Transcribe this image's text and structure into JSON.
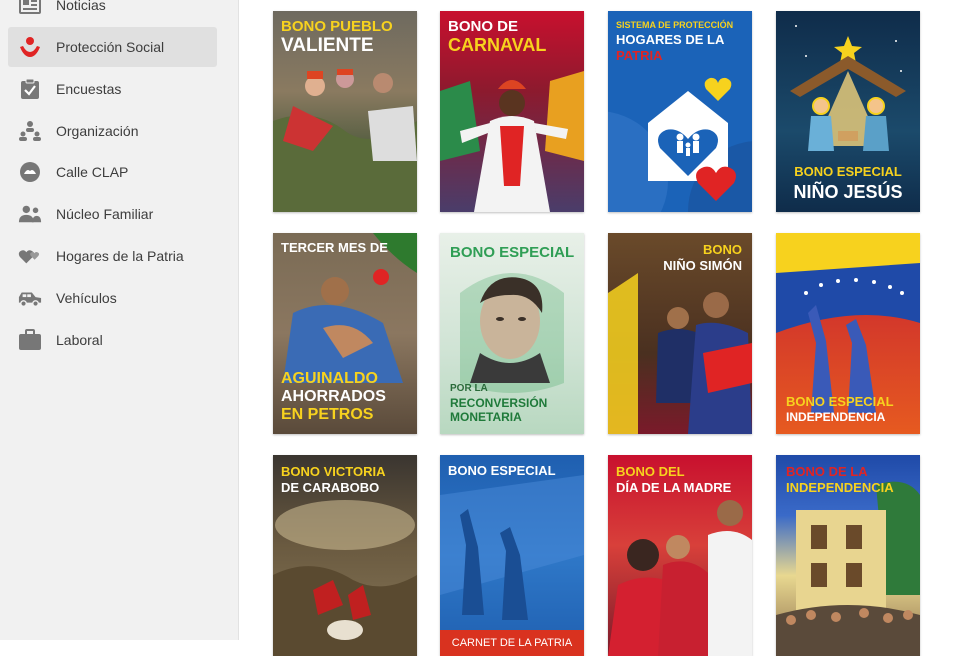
{
  "sidebar": {
    "items": [
      {
        "label": "Noticias",
        "icon": "newspaper-icon"
      },
      {
        "label": "Protección Social",
        "icon": "hands-heart-icon",
        "active": true
      },
      {
        "label": "Encuestas",
        "icon": "clipboard-check-icon"
      },
      {
        "label": "Organización",
        "icon": "org-chart-icon"
      },
      {
        "label": "Calle CLAP",
        "icon": "clap-icon"
      },
      {
        "label": "Núcleo Familiar",
        "icon": "family-icon"
      },
      {
        "label": "Hogares de la Patria",
        "icon": "hearts-icon"
      },
      {
        "label": "Vehículos",
        "icon": "car-icon"
      },
      {
        "label": "Laboral",
        "icon": "briefcase-icon"
      }
    ]
  },
  "colors": {
    "yellow": "#f7d21e",
    "red": "#e02424",
    "sidebar_bg": "#f1f1f1",
    "active_bg": "#e0e0e0"
  },
  "cards": [
    {
      "lines": [
        "BONO PUEBLO",
        "VALIENTE"
      ]
    },
    {
      "lines": [
        "BONO DE",
        "CARNAVAL"
      ]
    },
    {
      "lines": [
        "SISTEMA DE PROTECCIÓN",
        "HOGARES DE LA",
        "PATRIA"
      ]
    },
    {
      "lines": [
        "BONO ESPECIAL",
        "NIÑO JESÚS"
      ]
    },
    {
      "lines": [
        "TERCER MES DE",
        "AGUINALDO",
        "AHORRADOS",
        "EN PETROS"
      ]
    },
    {
      "lines": [
        "BONO ESPECIAL",
        "POR LA",
        "RECONVERSIÓN",
        "MONETARIA"
      ]
    },
    {
      "lines": [
        "BONO",
        "NIÑO SIMÓN"
      ]
    },
    {
      "lines": [
        "BONO ESPECIAL",
        "INDEPENDENCIA"
      ]
    },
    {
      "lines": [
        "BONO VICTORIA",
        "DE CARABOBO"
      ]
    },
    {
      "lines": [
        "BONO ESPECIAL",
        "CARNET DE LA PATRIA"
      ]
    },
    {
      "lines": [
        "BONO DEL",
        "DÍA DE LA MADRE"
      ]
    },
    {
      "lines": [
        "BONO DE LA",
        "INDEPENDENCIA"
      ]
    }
  ]
}
